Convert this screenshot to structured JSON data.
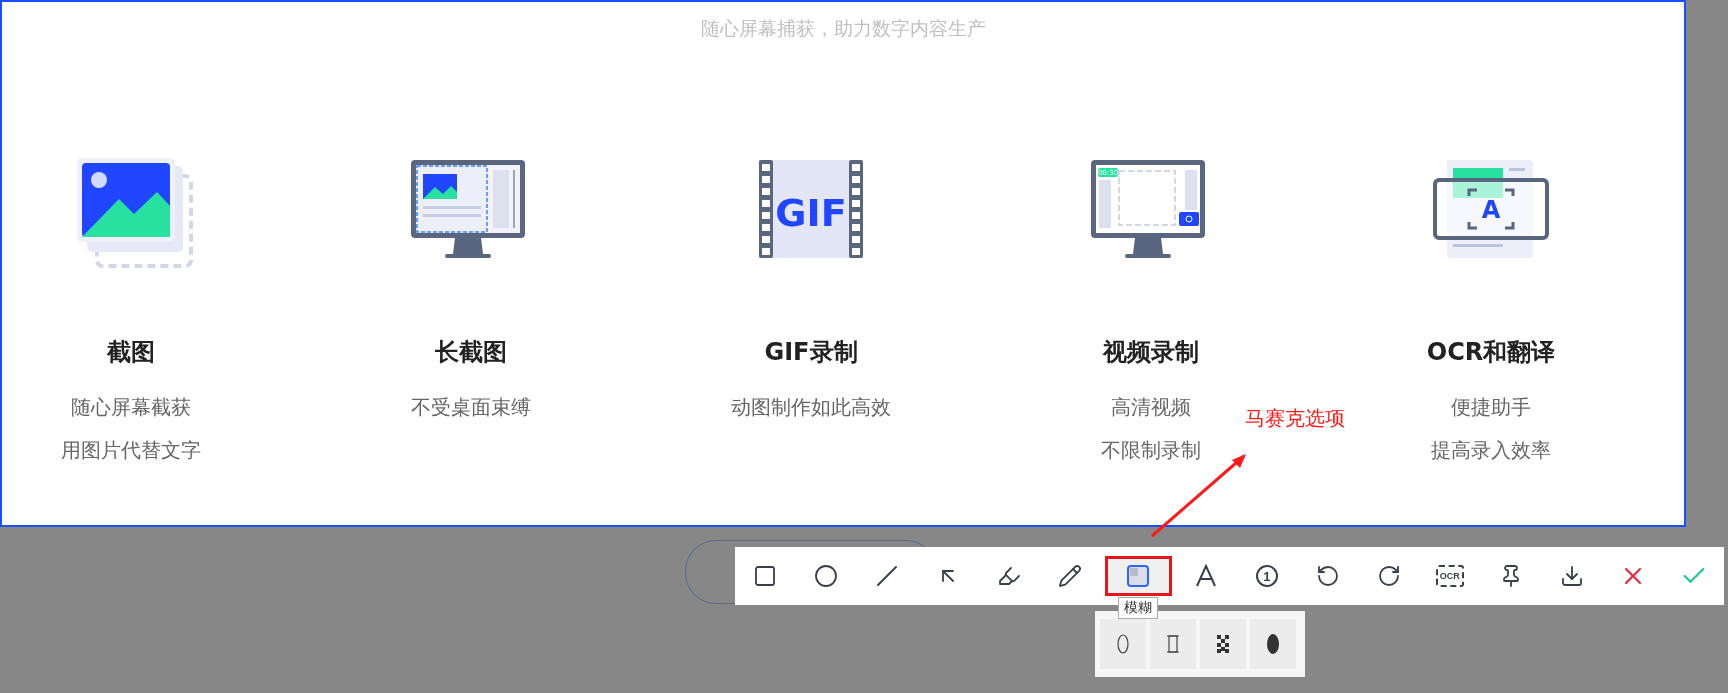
{
  "tagline": "随心屏幕捕获，助力数字内容生产",
  "features": [
    {
      "icon": {
        "kind": "gallery"
      },
      "title": "截图",
      "lines": [
        "随心屏幕截获",
        "用图片代替文字"
      ]
    },
    {
      "icon": {
        "kind": "long"
      },
      "title": "长截图",
      "lines": [
        "不受桌面束缚"
      ]
    },
    {
      "icon": {
        "kind": "gif",
        "text": "GIF"
      },
      "title": "GIF录制",
      "lines": [
        "动图制作如此高效"
      ]
    },
    {
      "icon": {
        "kind": "video",
        "text": "00:30"
      },
      "title": "视频录制",
      "lines": [
        "高清视频",
        "不限制录制"
      ]
    },
    {
      "icon": {
        "kind": "ocr",
        "text": "A"
      },
      "title": "OCR和翻译",
      "lines": [
        "便捷助手",
        "提高录入效率"
      ]
    }
  ],
  "toolbar": [
    {
      "kind": "rect",
      "selected": false
    },
    {
      "kind": "ellipse",
      "selected": false
    },
    {
      "kind": "line",
      "selected": false
    },
    {
      "kind": "arrow",
      "selected": false
    },
    {
      "kind": "marker",
      "selected": false
    },
    {
      "kind": "pencil",
      "selected": false
    },
    {
      "kind": "blur",
      "selected": true
    },
    {
      "kind": "text",
      "selected": false
    },
    {
      "kind": "step",
      "label": "1",
      "selected": false
    },
    {
      "kind": "undo",
      "selected": false
    },
    {
      "kind": "redo",
      "selected": false
    },
    {
      "kind": "ocr",
      "label": "OCR",
      "selected": false
    },
    {
      "kind": "pin",
      "selected": false
    },
    {
      "kind": "download",
      "selected": false
    },
    {
      "kind": "cancel",
      "selected": false
    },
    {
      "kind": "confirm",
      "selected": false
    }
  ],
  "tooltip": "模糊",
  "blur_options": [
    {
      "kind": "ellipse"
    },
    {
      "kind": "rect"
    },
    {
      "kind": "mosaic"
    },
    {
      "kind": "smudge"
    }
  ],
  "annotation": "马赛克选项"
}
